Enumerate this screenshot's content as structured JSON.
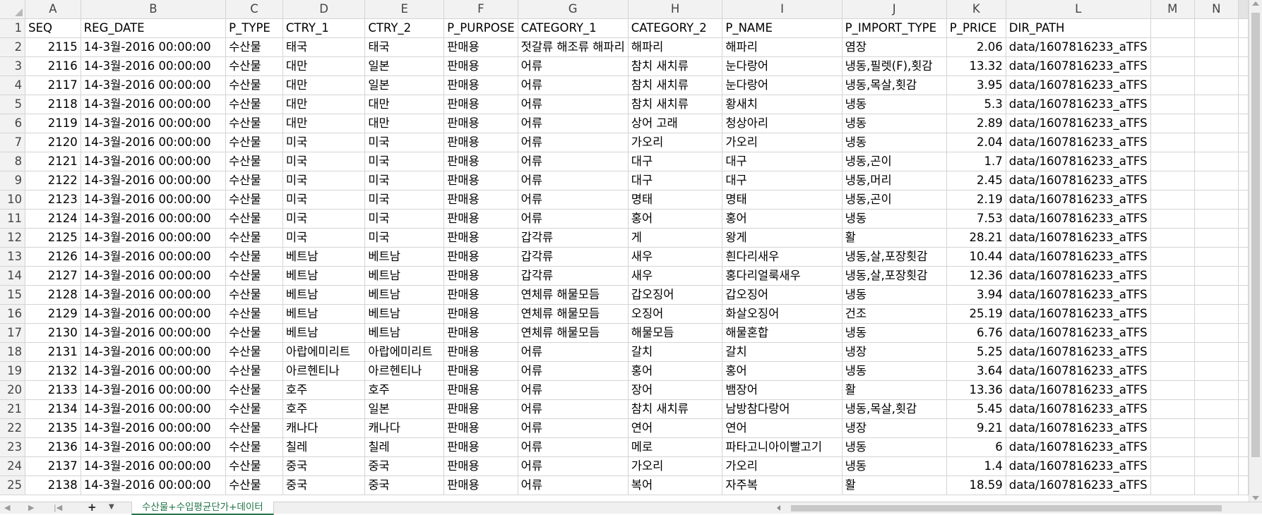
{
  "columns": [
    {
      "letter": "A",
      "width": 98
    },
    {
      "letter": "B",
      "width": 217
    },
    {
      "letter": "C",
      "width": 90
    },
    {
      "letter": "D",
      "width": 128
    },
    {
      "letter": "E",
      "width": 120
    },
    {
      "letter": "F",
      "width": 90
    },
    {
      "letter": "G",
      "width": 150
    },
    {
      "letter": "H",
      "width": 146
    },
    {
      "letter": "I",
      "width": 186
    },
    {
      "letter": "J",
      "width": 155
    },
    {
      "letter": "K",
      "width": 90
    },
    {
      "letter": "L",
      "width": 90
    },
    {
      "letter": "M",
      "width": 90
    },
    {
      "letter": "N",
      "width": 90
    },
    {
      "letter": "",
      "width": 18
    }
  ],
  "header_row": [
    "SEQ",
    "REG_DATE",
    "P_TYPE",
    "CTRY_1",
    "CTRY_2",
    "P_PURPOSE",
    "CATEGORY_1",
    "CATEGORY_2",
    "P_NAME",
    "P_IMPORT_TYPE",
    "P_PRICE",
    "DIR_PATH",
    "",
    ""
  ],
  "rows": [
    [
      "2115",
      "14-3월-2016 00:00:00",
      "수산물",
      "태국",
      "태국",
      "판매용",
      "젓갈류 해조류 해파리",
      "해파리",
      "해파리",
      "염장",
      "2.06",
      "data/1607816233_aTFS",
      "",
      ""
    ],
    [
      "2116",
      "14-3월-2016 00:00:00",
      "수산물",
      "대만",
      "일본",
      "판매용",
      "어류",
      "참치 새치류",
      "눈다랑어",
      "냉동,필렛(F),횟감",
      "13.32",
      "data/1607816233_aTFS",
      "",
      ""
    ],
    [
      "2117",
      "14-3월-2016 00:00:00",
      "수산물",
      "대만",
      "일본",
      "판매용",
      "어류",
      "참치 새치류",
      "눈다랑어",
      "냉동,목살,횟감",
      "3.95",
      "data/1607816233_aTFS",
      "",
      ""
    ],
    [
      "2118",
      "14-3월-2016 00:00:00",
      "수산물",
      "대만",
      "대만",
      "판매용",
      "어류",
      "참치 새치류",
      "황새치",
      "냉동",
      "5.3",
      "data/1607816233_aTFS",
      "",
      ""
    ],
    [
      "2119",
      "14-3월-2016 00:00:00",
      "수산물",
      "대만",
      "대만",
      "판매용",
      "어류",
      "상어 고래",
      "청상아리",
      "냉동",
      "2.89",
      "data/1607816233_aTFS",
      "",
      ""
    ],
    [
      "2120",
      "14-3월-2016 00:00:00",
      "수산물",
      "미국",
      "미국",
      "판매용",
      "어류",
      "가오리",
      "가오리",
      "냉동",
      "2.04",
      "data/1607816233_aTFS",
      "",
      ""
    ],
    [
      "2121",
      "14-3월-2016 00:00:00",
      "수산물",
      "미국",
      "미국",
      "판매용",
      "어류",
      "대구",
      "대구",
      "냉동,곤이",
      "1.7",
      "data/1607816233_aTFS",
      "",
      ""
    ],
    [
      "2122",
      "14-3월-2016 00:00:00",
      "수산물",
      "미국",
      "미국",
      "판매용",
      "어류",
      "대구",
      "대구",
      "냉동,머리",
      "2.45",
      "data/1607816233_aTFS",
      "",
      ""
    ],
    [
      "2123",
      "14-3월-2016 00:00:00",
      "수산물",
      "미국",
      "미국",
      "판매용",
      "어류",
      "명태",
      "명태",
      "냉동,곤이",
      "2.19",
      "data/1607816233_aTFS",
      "",
      ""
    ],
    [
      "2124",
      "14-3월-2016 00:00:00",
      "수산물",
      "미국",
      "미국",
      "판매용",
      "어류",
      "홍어",
      "홍어",
      "냉동",
      "7.53",
      "data/1607816233_aTFS",
      "",
      ""
    ],
    [
      "2125",
      "14-3월-2016 00:00:00",
      "수산물",
      "미국",
      "미국",
      "판매용",
      "갑각류",
      "게",
      "왕게",
      "활",
      "28.21",
      "data/1607816233_aTFS",
      "",
      ""
    ],
    [
      "2126",
      "14-3월-2016 00:00:00",
      "수산물",
      "베트남",
      "베트남",
      "판매용",
      "갑각류",
      "새우",
      "흰다리새우",
      "냉동,살,포장횟감",
      "10.44",
      "data/1607816233_aTFS",
      "",
      ""
    ],
    [
      "2127",
      "14-3월-2016 00:00:00",
      "수산물",
      "베트남",
      "베트남",
      "판매용",
      "갑각류",
      "새우",
      "홍다리얼룩새우",
      "냉동,살,포장횟감",
      "12.36",
      "data/1607816233_aTFS",
      "",
      ""
    ],
    [
      "2128",
      "14-3월-2016 00:00:00",
      "수산물",
      "베트남",
      "베트남",
      "판매용",
      "연체류 해물모듬",
      "갑오징어",
      "갑오징어",
      "냉동",
      "3.94",
      "data/1607816233_aTFS",
      "",
      ""
    ],
    [
      "2129",
      "14-3월-2016 00:00:00",
      "수산물",
      "베트남",
      "베트남",
      "판매용",
      "연체류 해물모듬",
      "오징어",
      "화살오징어",
      "건조",
      "25.19",
      "data/1607816233_aTFS",
      "",
      ""
    ],
    [
      "2130",
      "14-3월-2016 00:00:00",
      "수산물",
      "베트남",
      "베트남",
      "판매용",
      "연체류 해물모듬",
      "해물모듬",
      "해물혼합",
      "냉동",
      "6.76",
      "data/1607816233_aTFS",
      "",
      ""
    ],
    [
      "2131",
      "14-3월-2016 00:00:00",
      "수산물",
      "아랍에미리트",
      "아랍에미리트",
      "판매용",
      "어류",
      "갈치",
      "갈치",
      "냉장",
      "5.25",
      "data/1607816233_aTFS",
      "",
      ""
    ],
    [
      "2132",
      "14-3월-2016 00:00:00",
      "수산물",
      "아르헨티나",
      "아르헨티나",
      "판매용",
      "어류",
      "홍어",
      "홍어",
      "냉동",
      "3.64",
      "data/1607816233_aTFS",
      "",
      ""
    ],
    [
      "2133",
      "14-3월-2016 00:00:00",
      "수산물",
      "호주",
      "호주",
      "판매용",
      "어류",
      "장어",
      "뱀장어",
      "활",
      "13.36",
      "data/1607816233_aTFS",
      "",
      ""
    ],
    [
      "2134",
      "14-3월-2016 00:00:00",
      "수산물",
      "호주",
      "일본",
      "판매용",
      "어류",
      "참치 새치류",
      "남방참다랑어",
      "냉동,목살,횟감",
      "5.45",
      "data/1607816233_aTFS",
      "",
      ""
    ],
    [
      "2135",
      "14-3월-2016 00:00:00",
      "수산물",
      "캐나다",
      "캐나다",
      "판매용",
      "어류",
      "연어",
      "연어",
      "냉장",
      "9.21",
      "data/1607816233_aTFS",
      "",
      ""
    ],
    [
      "2136",
      "14-3월-2016 00:00:00",
      "수산물",
      "칠레",
      "칠레",
      "판매용",
      "어류",
      "메로",
      "파타고니아이빨고기",
      "냉동",
      "6",
      "data/1607816233_aTFS",
      "",
      ""
    ],
    [
      "2137",
      "14-3월-2016 00:00:00",
      "수산물",
      "중국",
      "중국",
      "판매용",
      "어류",
      "가오리",
      "가오리",
      "냉동",
      "1.4",
      "data/1607816233_aTFS",
      "",
      ""
    ],
    [
      "2138",
      "14-3월-2016 00:00:00",
      "수산물",
      "중국",
      "중국",
      "판매용",
      "어류",
      "복어",
      "자주복",
      "활",
      "18.59",
      "data/1607816233_aTFS",
      "",
      ""
    ]
  ],
  "numeric_columns": [
    0,
    10
  ],
  "sheet_tab": "수산물+수입평균단가+데이터",
  "add_sheet_label": "+",
  "sheet_menu_label": "▼",
  "nav_labels": [
    "◀",
    "▶",
    "|◀"
  ],
  "accent_color": "#217346"
}
